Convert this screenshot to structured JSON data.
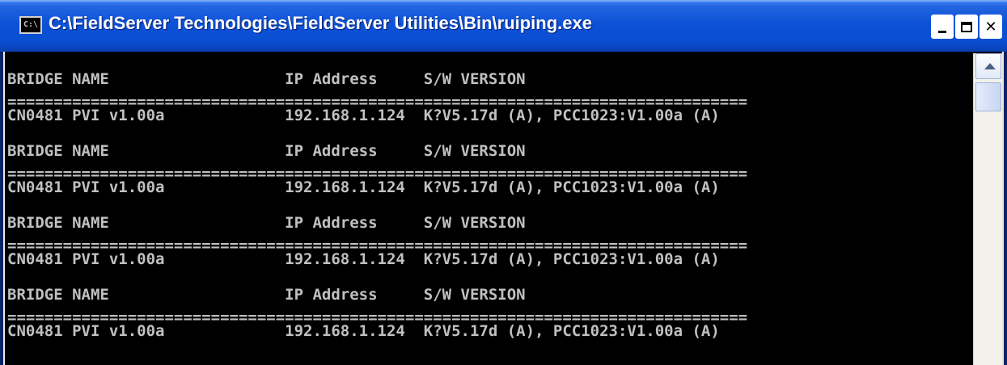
{
  "window": {
    "title": "C:\\FieldServer Technologies\\FieldServer Utilities\\Bin\\ruiping.exe",
    "icon_text": "C:\\",
    "icon": "console-app-icon",
    "controls": {
      "minimize": "minimize-icon",
      "maximize": "maximize-icon",
      "close": "close-icon",
      "close_glyph": "✕"
    }
  },
  "console": {
    "lines": [
      "BRIDGE NAME                   IP Address     S/W VERSION",
      "================================================================================",
      "CN0481 PVI v1.00a             192.168.1.124  K?V5.17d (A), PCC1023:V1.00a (A)",
      "BRIDGE NAME                   IP Address     S/W VERSION",
      "================================================================================",
      "CN0481 PVI v1.00a             192.168.1.124  K?V5.17d (A), PCC1023:V1.00a (A)",
      "BRIDGE NAME                   IP Address     S/W VERSION",
      "================================================================================",
      "CN0481 PVI v1.00a             192.168.1.124  K?V5.17d (A), PCC1023:V1.00a (A)",
      "BRIDGE NAME                   IP Address     S/W VERSION",
      "================================================================================",
      "CN0481 PVI v1.00a             192.168.1.124  K?V5.17d (A), PCC1023:V1.00a (A)"
    ]
  },
  "scrollbar": {
    "up_icon": "scroll-up-arrow-icon"
  },
  "colors": {
    "console_bg": "#000000",
    "console_text": "#c0c0c0",
    "title_bar": "#0a4fd2"
  }
}
